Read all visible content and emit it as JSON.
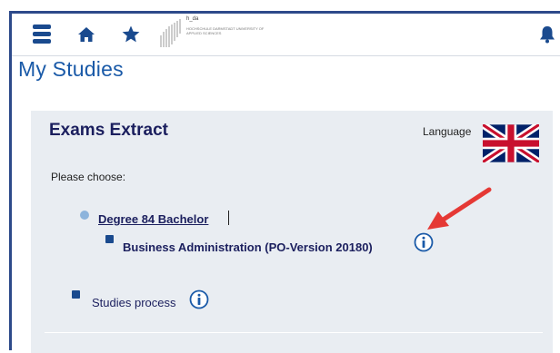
{
  "header": {
    "menu_icon": "hamburger-menu-icon",
    "home_icon": "home-icon",
    "favorites_icon": "star-icon",
    "logo_text": "h_da",
    "logo_subtext": "HOCHSCHULE DARMSTADT UNIVERSITY OF APPLIED SCIENCES",
    "notifications_icon": "bell-icon"
  },
  "page": {
    "title": "My Studies"
  },
  "panel": {
    "title": "Exams Extract",
    "language_label": "Language",
    "flag_icon": "uk-flag-icon",
    "prompt": "Please choose:",
    "degree_link": "Degree 84 Bachelor",
    "program_label": "Business Administration (PO-Version 20180)",
    "studies_process_label": "Studies process",
    "info_icon": "info-icon"
  },
  "colors": {
    "accent": "#1a5aa8",
    "navy_text": "#1b1f5e",
    "panel_bg": "#e9edf2",
    "annotation_arrow": "#e53935"
  }
}
